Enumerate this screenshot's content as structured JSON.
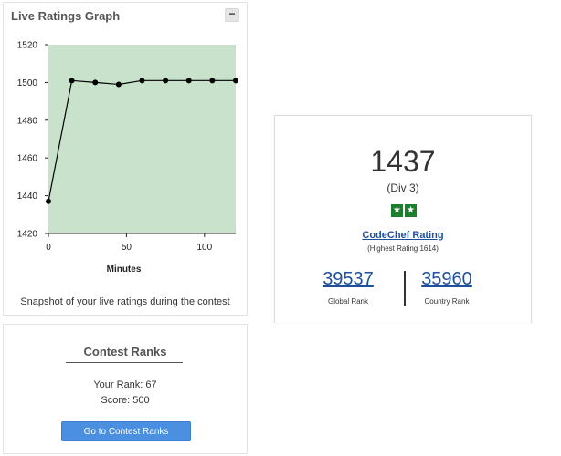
{
  "ratings_panel": {
    "title": "Live Ratings Graph",
    "collapse_symbol": "−",
    "caption": "Snapshot of your live ratings during the contest"
  },
  "chart_data": {
    "type": "line",
    "title": "",
    "xlabel": "Minutes",
    "ylabel": "",
    "x": [
      0,
      15,
      30,
      45,
      60,
      75,
      90,
      105,
      120
    ],
    "series": [
      {
        "values": [
          1437,
          1501,
          1500,
          1499,
          1501,
          1501,
          1501,
          1501,
          1501
        ]
      }
    ],
    "xlim": [
      0,
      120
    ],
    "ylim": [
      1420,
      1520
    ],
    "xticks": [
      0,
      50,
      100
    ],
    "yticks": [
      1420,
      1440,
      1460,
      1480,
      1500,
      1520
    ],
    "colors": {
      "plot_bg": "#c9e2cc",
      "line": "#000000",
      "marker": "#000000"
    },
    "grid": false,
    "legend": "none"
  },
  "profile": {
    "rating": "1437",
    "division": "(Div 3)",
    "stars": [
      "★",
      "★"
    ],
    "rating_link": "CodeChef Rating",
    "highest_rating": "(Highest Rating 1614)",
    "global_rank": "39537",
    "global_rank_label": "Global Rank",
    "country_rank": "35960",
    "country_rank_label": "Country Rank",
    "star_color": "#1b7f2e",
    "link_color": "#1e4f9e"
  },
  "contest_ranks": {
    "title": "Contest Ranks",
    "your_rank": "Your Rank: 67",
    "score": "Score: 500",
    "button_label": "Go to Contest Ranks",
    "button_color": "#4a8fe0"
  }
}
